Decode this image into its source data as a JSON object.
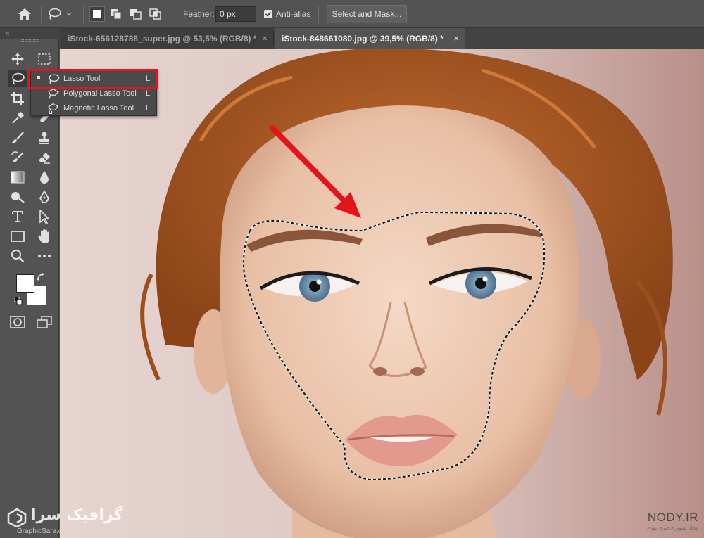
{
  "options_bar": {
    "feather_label": "Feather:",
    "feather_value": "0 px",
    "anti_alias_label": "Anti-alias",
    "anti_alias_checked": true,
    "select_and_mask_label": "Select and Mask..."
  },
  "tabs": [
    {
      "label": "iStock-656128788_super.jpg @ 53,5% (RGB/8) *",
      "active": false
    },
    {
      "label": "iStock-848661080.jpg @ 39,5% (RGB/8) *",
      "active": true
    }
  ],
  "tab_close_glyph": "×",
  "collapse_glyph": "«",
  "flyout": {
    "items": [
      {
        "label": "Lasso Tool",
        "shortcut": "L",
        "icon": "lasso-icon",
        "selected": true
      },
      {
        "label": "Polygonal Lasso Tool",
        "shortcut": "L",
        "icon": "polygonal-lasso-icon",
        "selected": false
      },
      {
        "label": "Magnetic Lasso Tool",
        "shortcut": "L",
        "icon": "magnetic-lasso-icon",
        "selected": false
      }
    ]
  },
  "colors": {
    "foreground": "#ffffff",
    "background": "#ffffff",
    "highlight": "#e3141a",
    "arrow": "#e3141a",
    "ui_bg": "#535353"
  },
  "watermark_left": {
    "text": "گرافیک سرا",
    "sub": "GraphicSara.com"
  },
  "watermark_right": {
    "text": "NODY.IR",
    "sub": "مجله تصویری خبری نودی"
  }
}
